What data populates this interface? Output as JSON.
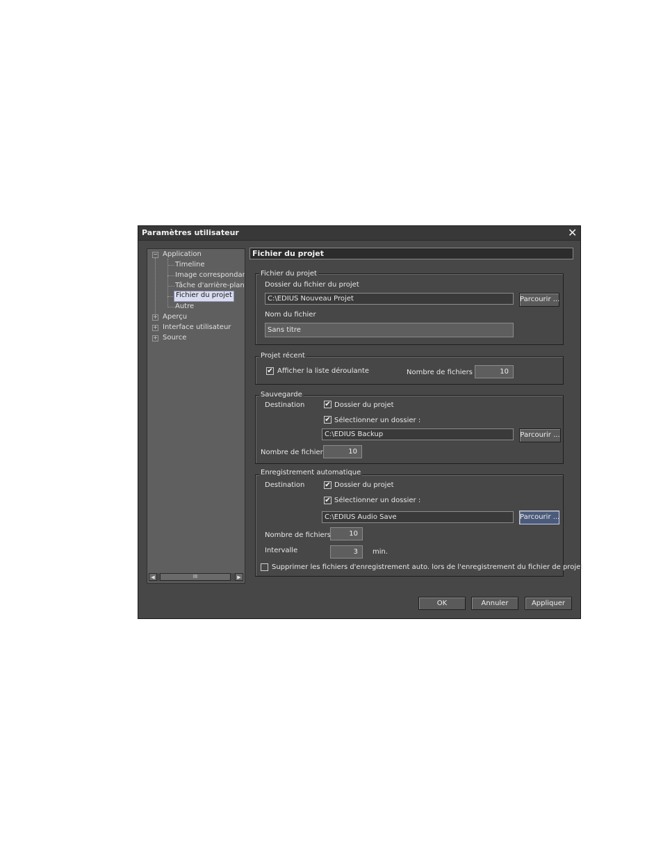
{
  "dialog": {
    "title": "Paramètres utilisateur",
    "close_glyph": "✕"
  },
  "tree": {
    "application": "Application",
    "timeline": "Timeline",
    "image_correspondante": "Image correspondante",
    "tache_arriere_plan": "Tâche d'arrière-plan",
    "fichier_du_projet": "Fichier du projet",
    "autre": "Autre",
    "apercu": "Aperçu",
    "interface_utilisateur": "Interface utilisateur",
    "source": "Source",
    "scroll_thumb_glyph": "III"
  },
  "section": {
    "title": "Fichier du projet"
  },
  "fichier_projet": {
    "group_label": "Fichier du projet",
    "folder_label": "Dossier du fichier du projet",
    "folder_value": "C:\\EDIUS Nouveau Projet",
    "browse_label": "Parcourir ...",
    "filename_label": "Nom du fichier",
    "filename_value": "Sans titre"
  },
  "projet_recent": {
    "group_label": "Projet récent",
    "show_list_label": "Afficher la liste déroulante",
    "show_list_checked": true,
    "count_label": "Nombre de fichiers",
    "count_value": "10"
  },
  "sauvegarde": {
    "group_label": "Sauvegarde",
    "destination_label": "Destination",
    "project_folder_label": "Dossier du projet",
    "select_folder_label": "Sélectionner un dossier :",
    "folder_value": "C:\\EDIUS Backup",
    "browse_label": "Parcourir ...",
    "count_label": "Nombre de fichiers",
    "count_value": "10"
  },
  "enregistrement_auto": {
    "group_label": "Enregistrement automatique",
    "destination_label": "Destination",
    "project_folder_label": "Dossier du projet",
    "select_folder_label": "Sélectionner un dossier :",
    "folder_value": "C:\\EDIUS Audio Save",
    "browse_label": "Parcourir ...",
    "count_label": "Nombre de fichiers",
    "count_value": "10",
    "interval_label": "Intervalle",
    "interval_value": "3",
    "interval_unit": "min.",
    "delete_label": "Supprimer les fichiers d'enregistrement auto. lors de l'enregistrement du fichier de projet",
    "delete_checked": false
  },
  "footer": {
    "ok_label": "OK",
    "cancel_label": "Annuler",
    "apply_label": "Appliquer"
  },
  "check_glyph": "✔"
}
